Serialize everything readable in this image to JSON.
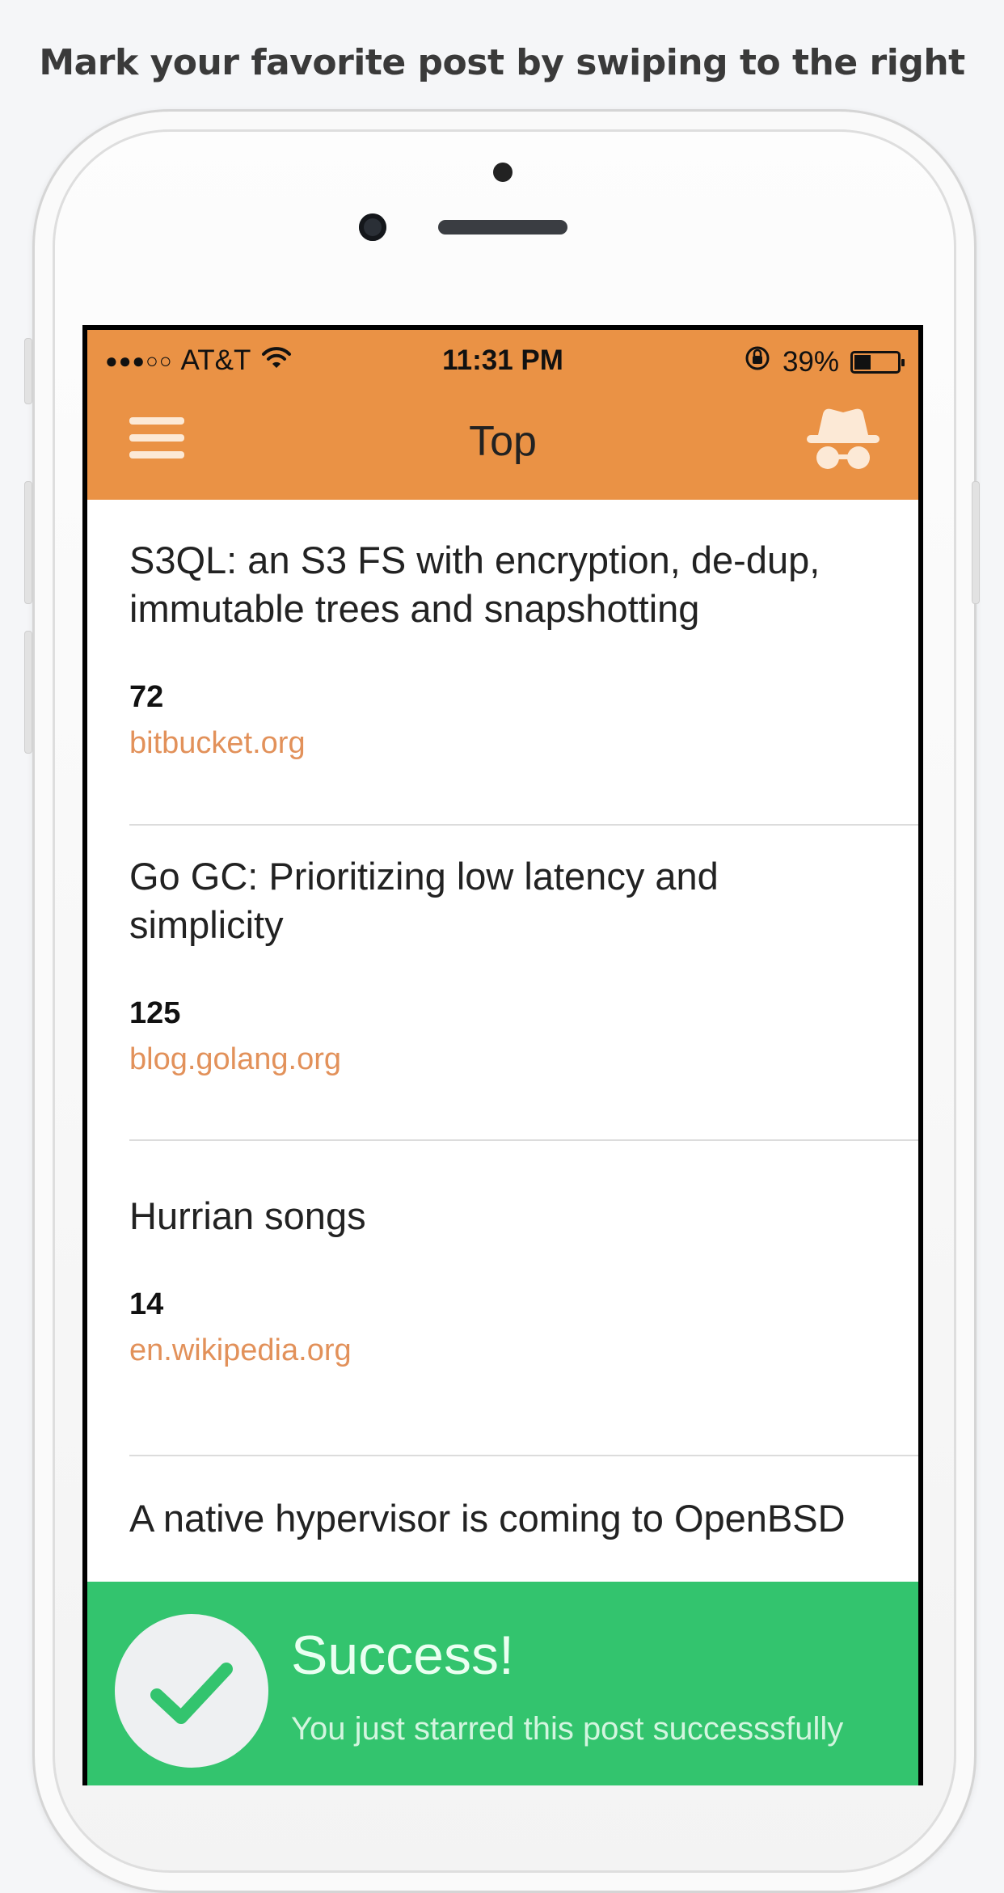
{
  "caption": "Mark your favorite post by swiping to the right",
  "status_bar": {
    "signal_dots": "●●●○○",
    "carrier": "AT&T",
    "time": "11:31 PM",
    "battery": "39%",
    "battery_level": 0.39
  },
  "navbar": {
    "title": "Top",
    "menu_icon": "hamburger-menu-icon",
    "right_icon": "incognito-icon"
  },
  "posts": [
    {
      "title": "S3QL: an S3 FS with encryption, de-dup, immutable trees and snapshotting",
      "score": "72",
      "domain": "bitbucket.org"
    },
    {
      "title": "Go GC: Prioritizing low latency and simplicity",
      "score": "125",
      "domain": "blog.golang.org"
    },
    {
      "title": "Hurrian songs",
      "score": "14",
      "domain": "en.wikipedia.org"
    },
    {
      "title": "A native hypervisor is coming to OpenBSD",
      "score": "",
      "domain": ""
    }
  ],
  "toast": {
    "title": "Success!",
    "message": "You just starred this post successsfully",
    "icon": "checkmark-icon"
  },
  "colors": {
    "accent": "#ea9245",
    "success": "#33c46e",
    "domain": "#e2915a"
  }
}
